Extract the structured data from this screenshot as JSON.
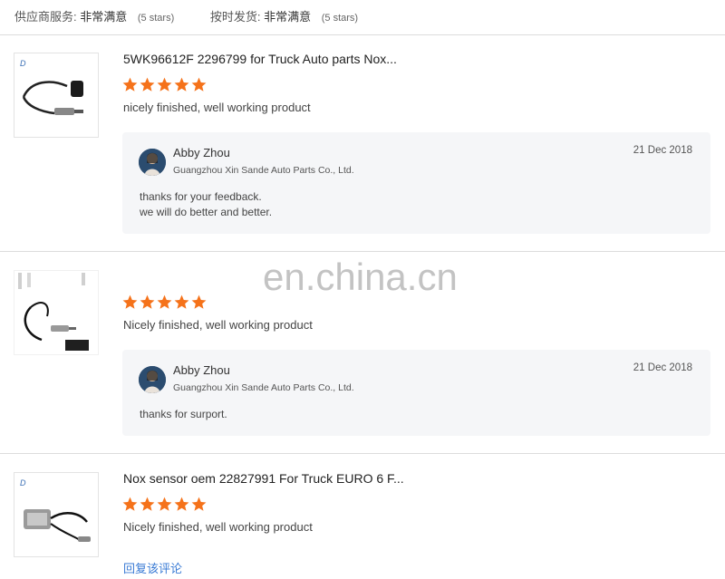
{
  "summary": {
    "supplier_service_label": "供应商服务:",
    "supplier_service_value": "非常满意",
    "supplier_service_stars": "(5 stars)",
    "on_time_label": "按时发货:",
    "on_time_value": "非常满意",
    "on_time_stars": "(5 stars)"
  },
  "colors": {
    "star": "#f5721a",
    "link": "#3a7bd5",
    "reply_bg": "#f5f6f8"
  },
  "reviews": [
    {
      "title": "5WK96612F 2296799 for Truck Auto parts Nox...",
      "rating": 5,
      "comment": "nicely finished, well working product",
      "reply": {
        "name": "Abby Zhou",
        "company": "Guangzhou Xin Sande Auto Parts Co., Ltd.",
        "date": "21 Dec 2018",
        "lines": [
          "thanks for your feedback.",
          "we will do better and better."
        ]
      }
    },
    {
      "title": "",
      "rating": 5,
      "comment": "Nicely finished, well working product",
      "reply": {
        "name": "Abby Zhou",
        "company": "Guangzhou Xin Sande Auto Parts Co., Ltd.",
        "date": "21 Dec 2018",
        "lines": [
          "thanks for surport."
        ]
      }
    },
    {
      "title": "Nox sensor oem 22827991 For Truck EURO 6 F...",
      "rating": 5,
      "comment": "Nicely finished, well working product",
      "reply_link": "回复该评论"
    }
  ],
  "watermark": "en.china.cn"
}
